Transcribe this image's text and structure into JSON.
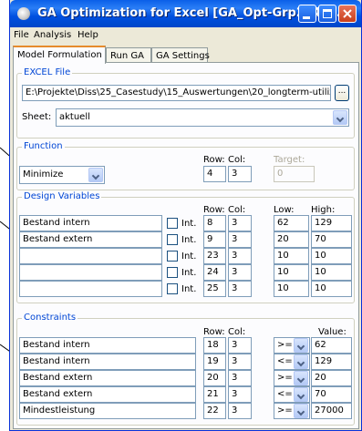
{
  "window": {
    "title": "GA Optimization for Excel [GA_Opt-Grp294_A..."
  },
  "menu": [
    "File",
    "Analysis",
    "Help"
  ],
  "tabs": [
    "Model Formulation",
    "Run GA",
    "GA Settings"
  ],
  "excel_file": {
    "group_label": "EXCEL File",
    "path": "E:\\Projekte\\Diss\\25_Casestudy\\15_Auswertungen\\20_longterm-utilizatio",
    "browse_label": "...",
    "sheet_label": "Sheet:",
    "sheet_value": "aktuell"
  },
  "function": {
    "group_label": "Function",
    "mode": "Minimize",
    "row_label": "Row:",
    "col_label": "Col:",
    "target_label": "Target:",
    "row": "4",
    "col": "3",
    "target": "0"
  },
  "design_variables": {
    "group_label": "Design Variables",
    "row_label": "Row:",
    "col_label": "Col:",
    "low_label": "Low:",
    "high_label": "High:",
    "int_label": "Int.",
    "rows": [
      {
        "name": "Bestand intern",
        "row": "8",
        "col": "3",
        "low": "62",
        "high": "129"
      },
      {
        "name": "Bestand extern",
        "row": "9",
        "col": "3",
        "low": "20",
        "high": "70"
      },
      {
        "name": "",
        "row": "23",
        "col": "3",
        "low": "10",
        "high": "10"
      },
      {
        "name": "",
        "row": "24",
        "col": "3",
        "low": "10",
        "high": "10"
      },
      {
        "name": "",
        "row": "25",
        "col": "3",
        "low": "10",
        "high": "10"
      }
    ]
  },
  "constraints": {
    "group_label": "Constraints",
    "row_label": "Row:",
    "col_label": "Col:",
    "value_label": "Value:",
    "rows": [
      {
        "name": "Bestand intern",
        "row": "18",
        "col": "3",
        "op": ">=",
        "value": "62"
      },
      {
        "name": "Bestand intern",
        "row": "19",
        "col": "3",
        "op": "<=",
        "value": "129"
      },
      {
        "name": "Bestand extern",
        "row": "20",
        "col": "3",
        "op": ">=",
        "value": "20"
      },
      {
        "name": "Bestand extern",
        "row": "21",
        "col": "3",
        "op": "<=",
        "value": "70"
      },
      {
        "name": "Mindestleistung",
        "row": "22",
        "col": "3",
        "op": ">=",
        "value": "27000"
      }
    ]
  }
}
